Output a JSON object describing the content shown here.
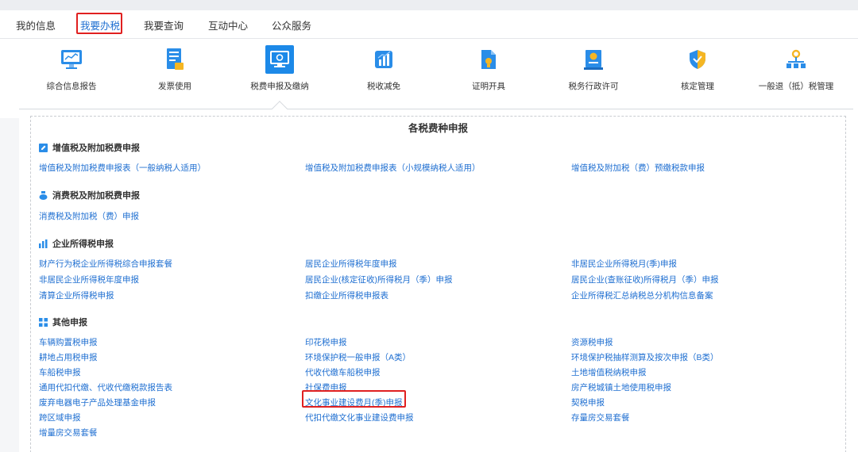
{
  "tabs": [
    {
      "label": "我的信息"
    },
    {
      "label": "我要办税"
    },
    {
      "label": "我要查询"
    },
    {
      "label": "互动中心"
    },
    {
      "label": "公众服务"
    }
  ],
  "icon_menu": [
    {
      "label": "综合信息报告",
      "icon": "monitor-chart-icon"
    },
    {
      "label": "发票使用",
      "icon": "invoice-document-icon"
    },
    {
      "label": "税费申报及缴纳",
      "icon": "screen-declare-icon"
    },
    {
      "label": "税收减免",
      "icon": "bar-chart-icon"
    },
    {
      "label": "证明开具",
      "icon": "certificate-file-icon"
    },
    {
      "label": "税务行政许可",
      "icon": "license-badge-icon"
    },
    {
      "label": "核定管理",
      "icon": "shield-icon"
    },
    {
      "label": "一般退（抵）税管理",
      "icon": "org-tree-icon"
    }
  ],
  "panel_title": "各税费种申报",
  "sections": {
    "vat": {
      "title": "增值税及附加税费申报",
      "links": [
        "增值税及附加税费申报表（一般纳税人适用）",
        "增值税及附加税费申报表（小规模纳税人适用）",
        "增值税及附加税（费）预缴税款申报"
      ]
    },
    "consumption": {
      "title": "消费税及附加税费申报",
      "links": [
        "消费税及附加税（费）申报"
      ]
    },
    "cit": {
      "title": "企业所得税申报",
      "links": [
        "财产行为税企业所得税综合申报套餐",
        "居民企业所得税年度申报",
        "非居民企业所得税月(季)申报",
        "非居民企业所得税年度申报",
        "居民企业(核定征收)所得税月（季）申报",
        "居民企业(查账征收)所得税月（季）申报",
        "清算企业所得税申报",
        "扣缴企业所得税申报表",
        "企业所得税汇总纳税总分机构信息备案"
      ]
    },
    "other": {
      "title": "其他申报",
      "links": [
        "车辆购置税申报",
        "印花税申报",
        "资源税申报",
        "耕地占用税申报",
        "环境保护税一般申报（A类）",
        "环境保护税抽样测算及按次申报（B类）",
        "车船税申报",
        "代收代缴车船税申报",
        "土地增值税纳税申报",
        "通用代扣代缴、代收代缴税款报告表",
        "社保费申报",
        "房产税城镇土地使用税申报",
        "废弃电器电子产品处理基金申报",
        "文化事业建设费月(季)申报",
        "契税申报",
        "跨区域申报",
        "代扣代缴文化事业建设费申报",
        "存量房交易套餐",
        "增量房交易套餐"
      ]
    }
  },
  "colors": {
    "accent": "#1f6fd1",
    "highlight": "#e02020",
    "selected_icon_bg": "#1c89e8"
  }
}
